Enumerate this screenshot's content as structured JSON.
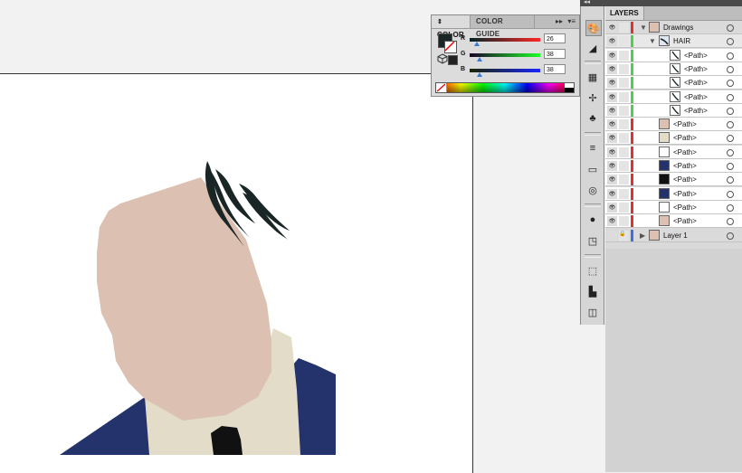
{
  "color_panel": {
    "tab_color": "COLOR",
    "tab_color_guide": "COLOR GUIDE",
    "channels": [
      {
        "label": "R",
        "value": "26",
        "fraction": 0.102
      },
      {
        "label": "G",
        "value": "38",
        "fraction": 0.149
      },
      {
        "label": "B",
        "value": "38",
        "fraction": 0.149
      }
    ],
    "fill_color": "#1a2626"
  },
  "layers_panel": {
    "tab": "LAYERS",
    "rows": [
      {
        "label": "Drawings",
        "kind": "layer",
        "color": "#e03030"
      },
      {
        "label": "HAIR",
        "kind": "sublayer",
        "color": "#4cd14c"
      },
      {
        "label": "<Path>",
        "kind": "path-hair",
        "color": "#4cd14c"
      },
      {
        "label": "<Path>",
        "kind": "path-hair",
        "color": "#4cd14c"
      },
      {
        "label": "<Path>",
        "kind": "path-hair",
        "color": "#4cd14c"
      },
      {
        "label": "<Path>",
        "kind": "path-hair",
        "color": "#4cd14c"
      },
      {
        "label": "<Path>",
        "kind": "path-hair",
        "color": "#4cd14c"
      },
      {
        "label": "<Path>",
        "kind": "path",
        "color": "#e03030"
      },
      {
        "label": "<Path>",
        "kind": "path",
        "color": "#e03030"
      },
      {
        "label": "<Path>",
        "kind": "path",
        "color": "#e03030"
      },
      {
        "label": "<Path>",
        "kind": "path",
        "color": "#e03030"
      },
      {
        "label": "<Path>",
        "kind": "path",
        "color": "#e03030"
      },
      {
        "label": "<Path>",
        "kind": "path",
        "color": "#e03030"
      },
      {
        "label": "<Path>",
        "kind": "path",
        "color": "#e03030"
      },
      {
        "label": "<Path>",
        "kind": "path",
        "color": "#e03030"
      },
      {
        "label": "Layer 1",
        "kind": "layer2",
        "color": "#3d6ee0"
      }
    ]
  },
  "colors": {
    "skin": "#dcc0b1",
    "suit": "#24336b",
    "shirt": "#e3dcc8",
    "tie": "#111111",
    "hair": "#1a2626"
  }
}
